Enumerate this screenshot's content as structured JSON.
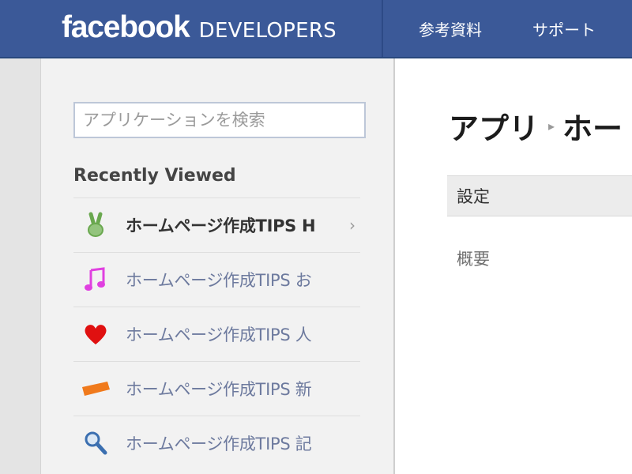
{
  "header": {
    "logo_text": "facebook",
    "logo_suffix": "DEVELOPERS",
    "nav": [
      "参考資料",
      "サポート"
    ]
  },
  "sidebar": {
    "search_placeholder": "アプリケーションを検索",
    "recent_title": "Recently Viewed",
    "apps": [
      {
        "name": "ホームページ作成TIPS H",
        "icon": "peace-hand-icon",
        "active": true
      },
      {
        "name": "ホームページ作成TIPS お",
        "icon": "music-note-icon",
        "active": false
      },
      {
        "name": "ホームページ作成TIPS 人",
        "icon": "heart-icon",
        "active": false
      },
      {
        "name": "ホームページ作成TIPS 新",
        "icon": "ticket-icon",
        "active": false
      },
      {
        "name": "ホームページ作成TIPS 記",
        "icon": "magnifier-icon",
        "active": false
      }
    ],
    "chevron": "›"
  },
  "main": {
    "breadcrumb": [
      "アプリ",
      "ホー"
    ],
    "breadcrumb_separator": "▸",
    "settings_label": "設定",
    "summary_label": "概要"
  },
  "colors": {
    "header_bg": "#3b5998",
    "sidebar_bg": "#f2f2f2",
    "link_text": "#6d7a9e",
    "music_icon": "#e040e0",
    "heart_icon": "#e01010",
    "ticket_icon": "#f07a1c",
    "magnifier_icon": "#3b6fb0"
  }
}
